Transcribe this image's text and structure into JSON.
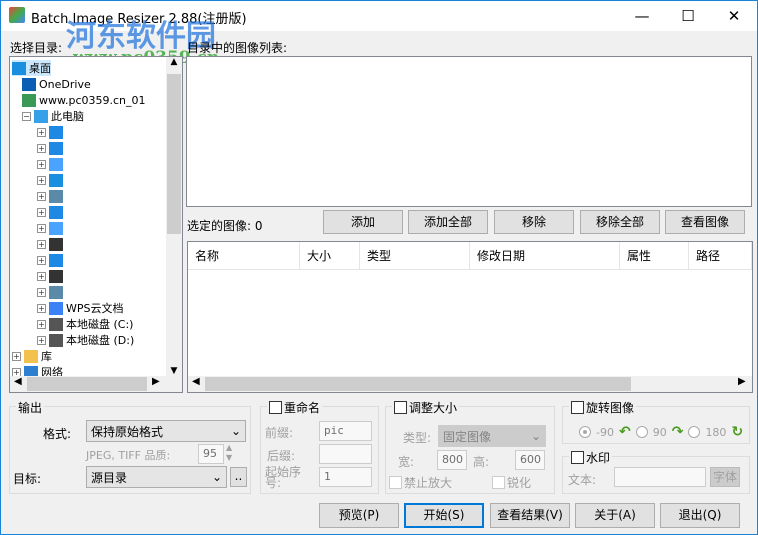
{
  "window": {
    "title": "Batch Image Resizer 2.88(注册版)",
    "minimize": "—",
    "maximize": "☐",
    "close": "✕"
  },
  "watermark": {
    "brand": "河东软件园",
    "url": "www.pc0359.cn"
  },
  "tree": {
    "label": "选择目录:",
    "items": [
      {
        "label": "桌面",
        "icon": "desktop-icon"
      },
      {
        "label": "OneDrive",
        "icon": "onedrive-icon"
      },
      {
        "label": "www.pc0359.cn_01",
        "icon": "user-icon"
      },
      {
        "label": "此电脑",
        "icon": "computer-icon"
      },
      {
        "label": "WPS云文档",
        "icon": "cloud-icon"
      },
      {
        "label": "本地磁盘 (C:)",
        "icon": "drive-icon"
      },
      {
        "label": "本地磁盘 (D:)",
        "icon": "drive-icon"
      },
      {
        "label": "库",
        "icon": "library-icon"
      },
      {
        "label": "网络",
        "icon": "network-icon"
      }
    ],
    "pc_children_icons": [
      "download-icon",
      "music-icon",
      "document-icon",
      "desktop-icon",
      "picture-icon",
      "download-icon",
      "document-icon",
      "video-icon",
      "music-icon",
      "video-icon",
      "picture-icon"
    ]
  },
  "dir_list": {
    "label": "目录中的图像列表:"
  },
  "selected": {
    "label": "选定的图像: 0"
  },
  "actions": [
    "添加",
    "添加全部",
    "移除",
    "移除全部",
    "查看图像"
  ],
  "table": {
    "columns": [
      "名称",
      "大小",
      "类型",
      "修改日期",
      "属性",
      "路径"
    ]
  },
  "output": {
    "title": "输出",
    "format_label": "格式:",
    "format_value": "保持原始格式",
    "quality_label": "JPEG, TIFF 品质:",
    "quality_value": "95",
    "target_label": "目标:",
    "target_value": "源目录",
    "browse": ".."
  },
  "rename": {
    "title": "重命名",
    "prefix_label": "前缀:",
    "prefix_value": "pic",
    "suffix_label": "后缀:",
    "suffix_value": "",
    "start_label": "起始序号:",
    "start_value": "1"
  },
  "resize": {
    "title": "调整大小",
    "type_label": "类型:",
    "type_value": "固定图像",
    "width_label": "宽:",
    "width_value": "800",
    "height_label": "高:",
    "height_value": "600",
    "no_enlarge": "禁止放大",
    "sharpen": "锐化"
  },
  "rotate": {
    "title": "旋转图像",
    "options": [
      "-90",
      "90",
      "180"
    ],
    "selected": "-90"
  },
  "watermark_group": {
    "title": "水印",
    "text_label": "文本:",
    "text_value": "",
    "font_button": "字体"
  },
  "buttons": {
    "preview": "预览(P)",
    "start": "开始(S)",
    "view_results": "查看结果(V)",
    "about": "关于(A)",
    "exit": "退出(Q)"
  }
}
